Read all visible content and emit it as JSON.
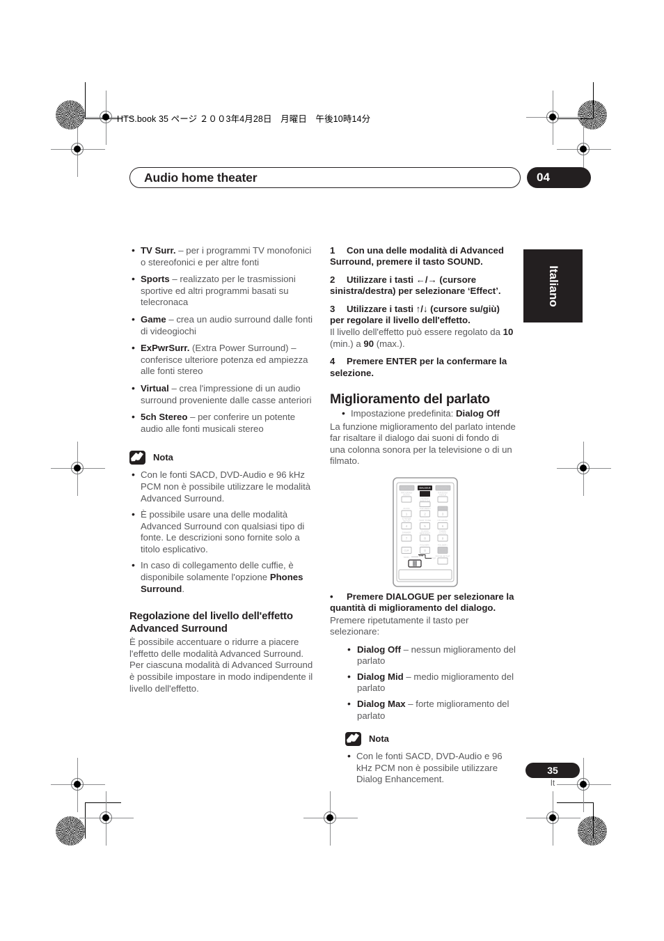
{
  "print": {
    "file_line": "HTS.book 35 ページ ２００3年4月28日　月曜日　午後10時14分"
  },
  "header": {
    "chapter_title": "Audio home theater",
    "chapter_number": "04",
    "language_tab": "Italiano"
  },
  "left_column": {
    "modes": [
      {
        "term": "TV Surr.",
        "desc": " – per i programmi TV monofonici o stereofonici e per altre fonti"
      },
      {
        "term": "Sports",
        "desc": " – realizzato per le trasmissioni sportive ed altri programmi basati su telecronaca"
      },
      {
        "term": "Game",
        "desc": " – crea un audio surround dalle fonti di videogiochi"
      },
      {
        "term": "ExPwrSurr.",
        "desc": " (Extra Power Surround) – conferisce ulteriore potenza ed ampiezza alle fonti stereo"
      },
      {
        "term": "Virtual",
        "desc": " – crea l'impressione di un audio surround proveniente dalle casse anteriori"
      },
      {
        "term": "5ch Stereo",
        "desc": " – per conferire un potente audio alle fonti musicali stereo"
      }
    ],
    "note_label": "Nota",
    "notes": [
      "Con le fonti SACD, DVD-Audio e 96 kHz PCM non è possibile utilizzare le modalità Advanced Surround.",
      "È possibile usare una delle modalità Advanced Surround con qualsiasi tipo di fonte. Le descrizioni sono fornite solo a titolo esplicativo."
    ],
    "note_phones_prefix": "In caso di collegamento delle cuffie, è disponibile solamente l'opzione ",
    "note_phones_bold": "Phones Surround",
    "note_phones_suffix": ".",
    "section_heading": "Regolazione del livello dell'effetto Advanced Surround",
    "section_body": "È possibile accentuare o ridurre a piacere l'effetto delle modalità Advanced Surround. Per ciascuna modalità di Advanced Surround è possibile impostare in modo indipendente il livello dell'effetto."
  },
  "right_column": {
    "steps": [
      {
        "num": "1",
        "text": "Con una delle modalità di Advanced Surround, premere il tasto SOUND.",
        "sub": ""
      },
      {
        "num": "2",
        "text": "Utilizzare i tasti ←/→ (cursore sinistra/destra) per selezionare ‘Effect’.",
        "sub": ""
      },
      {
        "num": "3",
        "text": "Utilizzare i tasti ↑/↓ (cursore su/giù) per regolare il livello dell'effetto.",
        "sub": "Il livello dell'effetto può essere regolato da 10 (min.) a 90 (max.)."
      },
      {
        "num": "4",
        "text": "Premere ENTER per la confermare la selezione.",
        "sub": ""
      }
    ],
    "step3_sub_part1": "Il livello dell'effetto può essere regolato da ",
    "step3_sub_min": "10",
    "step3_sub_part2": " (min.) a ",
    "step3_sub_max": "90",
    "step3_sub_part3": " (max.).",
    "heading": "Miglioramento del parlato",
    "default_prefix": "Impostazione predefinita: ",
    "default_value": "Dialog Off",
    "intro": "La funzione miglioramento del parlato intende far risaltare il dialogo dai suoni di fondo di una colonna sonora per la televisione o di un filmato.",
    "dialogue_instruction": "Premere DIALOGUE per selezionare la quantità di miglioramento del dialogo.",
    "dialogue_sub": "Premere ripetutamente il tasto per selezionare:",
    "dialog_options": [
      {
        "term": "Dialog Off",
        "desc": " – nessun miglioramento del parlato"
      },
      {
        "term": "Dialog Mid",
        "desc": " – medio miglioramento del parlato"
      },
      {
        "term": "Dialog Max",
        "desc": " – forte miglioramento del parlato"
      }
    ],
    "note_label": "Nota",
    "note_text": "Con le fonti SACD, DVD-Audio e 96 kHz PCM non è possibile utilizzare Dialog Enhancement."
  },
  "remote": {
    "highlighted_button": "DIALOGUE",
    "rows": [
      [
        "BASS MODE\nAUTO",
        "DIALOGUE",
        "VIRTUAL SB\nADVANCED"
      ],
      [
        "PROGRAM\nAUDIO",
        "REPEAT\nSUBTITLE",
        "RANDOM\nANGLE"
      ],
      [
        "ZOOM",
        "TOP MENU",
        "DISC\nMENU"
      ],
      [
        "SYSTEM\nSETUP",
        "TEST TONE",
        "CH LEVEL"
      ],
      [
        "DIMMER",
        "CLASS/\nMIDNIGHT",
        "TIMER/\nCLOCK"
      ],
      [
        "",
        "FOLDER–",
        "FOLDER+"
      ]
    ],
    "keys": [
      "1",
      "2",
      "3",
      "4",
      "5",
      "6",
      "7",
      "8",
      "9",
      "0"
    ],
    "clear_key": "CLR",
    "disc_key": "DISC",
    "room_setup": "ROOM SETUP",
    "slider_left": "MAIN",
    "slider_mid": "SUB",
    "slider_right": "PDP"
  },
  "footer": {
    "page_number": "35",
    "page_language_code": "It"
  }
}
